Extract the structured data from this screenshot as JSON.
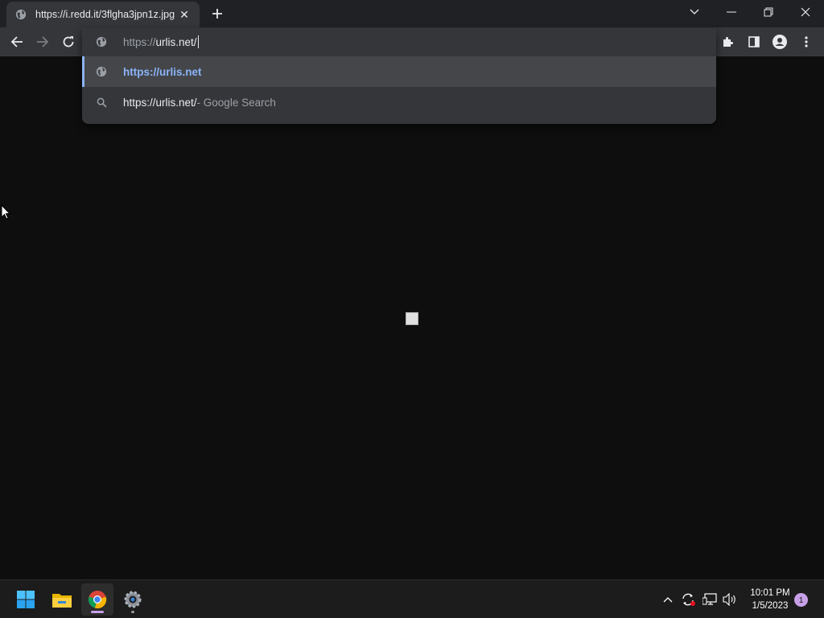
{
  "browser": {
    "tab_title": "https://i.redd.it/3flgha3jpn1z.jpg",
    "tab_close_glyph": "✕",
    "new_tab_glyph": "+",
    "icons": {
      "tab_favicon": "globe-icon",
      "new_tab": "plus-icon",
      "tab_search": "chevron-down-icon",
      "minimize": "minimize-icon",
      "restore": "restore-icon",
      "close": "close-icon",
      "back": "back-arrow-icon",
      "forward": "forward-arrow-icon",
      "reload": "reload-icon",
      "extensions": "puzzle-icon",
      "side_panel": "side-panel-icon",
      "profile": "profile-icon",
      "menu": "kebab-menu-icon"
    }
  },
  "omnibox": {
    "input_prefix": "https://",
    "input_main": "urlis.net/",
    "suggestions": [
      {
        "icon": "globe-icon",
        "text": "https://urlis.net",
        "suffix": ""
      },
      {
        "icon": "search-icon",
        "text": "https://urlis.net/",
        "suffix": " - Google Search"
      }
    ]
  },
  "taskbar": {
    "apps": [
      "windows-start-icon",
      "file-explorer-icon",
      "chrome-icon",
      "settings-icon"
    ],
    "time": "10:01 PM",
    "date": "1/5/2023",
    "notification_count": "1"
  },
  "colors": {
    "accent": "#8ab4f8",
    "toolbar_bg": "#35363a",
    "page_bg": "#0e0e0f",
    "taskbar_bg": "#1c1c1c",
    "indicator": "#c8a0e8"
  }
}
